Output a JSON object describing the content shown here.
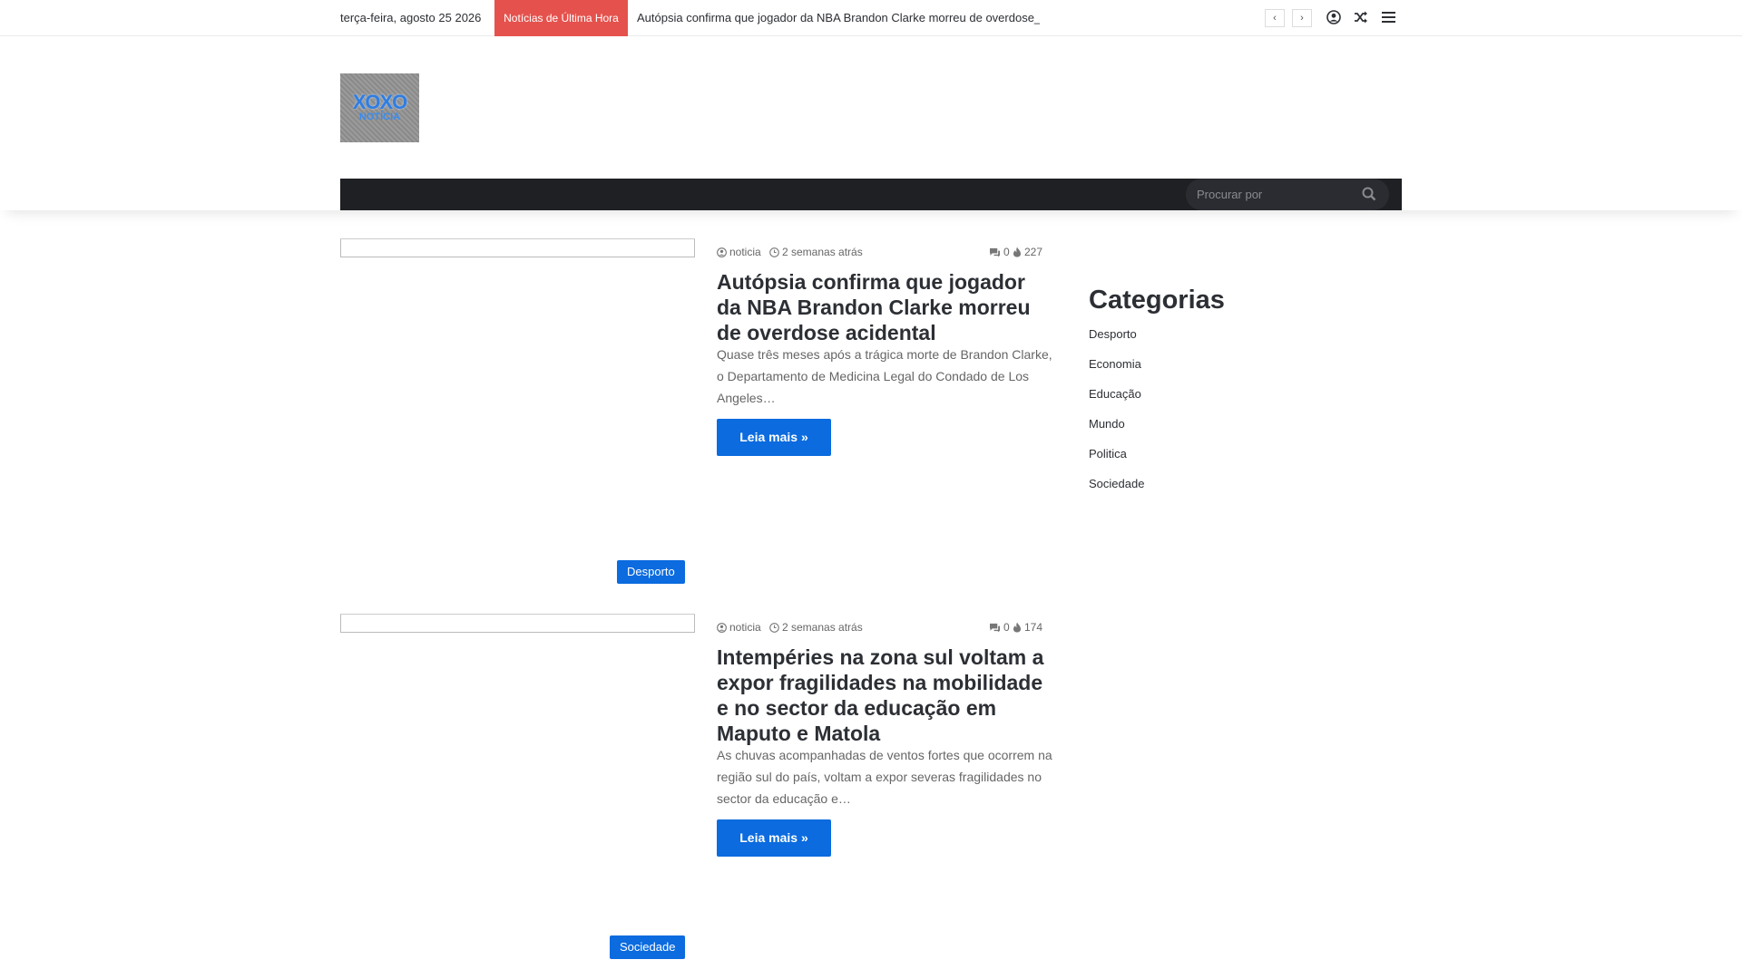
{
  "topbar": {
    "date": "terça-feira, agosto 25 2026",
    "breaking_label": "Notícias de Última Hora",
    "breaking_text": "Autópsia confirma que jogador da NBA Brandon Clarke morreu de overdose_",
    "prev_label": "‹",
    "next_label": "›"
  },
  "logo": {
    "line1": "XOXO",
    "line2": "NOTÍCIA"
  },
  "search": {
    "placeholder": "Procurar por"
  },
  "posts": [
    {
      "author": "noticia",
      "time": "2 semanas atrás",
      "comments": "0",
      "views": "227",
      "title": "Autópsia confirma que jogador da NBA Brandon Clarke morreu de overdose acidental",
      "excerpt": "Quase três meses após a trágica morte de Brandon Clarke, o Departamento de Medicina Legal do Condado de Los Angeles…",
      "read_more": "Leia mais »",
      "category": "Desporto"
    },
    {
      "author": "noticia",
      "time": "2 semanas atrás",
      "comments": "0",
      "views": "174",
      "title": "Intempéries na zona sul voltam a expor fragilidades na mobilidade e no sector da educação em Maputo e Matola",
      "excerpt": "As chuvas acompanhadas de ventos fortes que ocorrem na região sul do país, voltam a expor severas fragilidades no sector da educação e…",
      "read_more": "Leia mais »",
      "category": "Sociedade"
    }
  ],
  "sidebar": {
    "heading": "Categorias",
    "categories": [
      "Desporto",
      "Economia",
      "Educação",
      "Mundo",
      "Politica",
      "Sociedade"
    ]
  },
  "colors": {
    "accent": "#0b6bdf",
    "breaking": "#e5524d",
    "nav": "#1f2024"
  }
}
